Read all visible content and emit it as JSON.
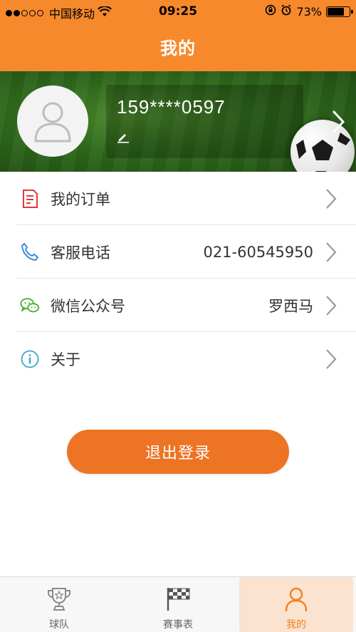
{
  "status": {
    "carrier": "中国移动",
    "time": "09:25",
    "battery": "73%",
    "battery_level": 0.73
  },
  "header": {
    "title": "我的"
  },
  "profile": {
    "phone": "159****0597"
  },
  "menu": {
    "items": [
      {
        "label": "我的订单",
        "value": "",
        "icon": "order-icon"
      },
      {
        "label": "客服电话",
        "value": "021-60545950",
        "icon": "phone-icon"
      },
      {
        "label": "微信公众号",
        "value": "罗西马",
        "icon": "wechat-icon"
      },
      {
        "label": "关于",
        "value": "",
        "icon": "info-icon"
      }
    ]
  },
  "logout": {
    "label": "退出登录"
  },
  "tabs": [
    {
      "label": "球队",
      "icon": "trophy-icon"
    },
    {
      "label": "赛事表",
      "icon": "flag-icon"
    },
    {
      "label": "我的",
      "icon": "person-icon",
      "active": true
    }
  ],
  "colors": {
    "accent": "#f6892c",
    "button": "#ec7424",
    "active_tab_bg": "#fbe3cf"
  }
}
